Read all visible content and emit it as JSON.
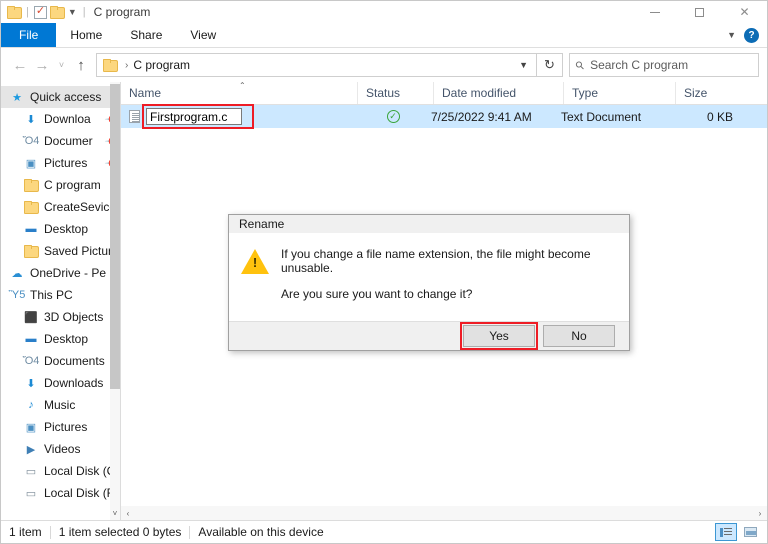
{
  "titlebar": {
    "title": "C program",
    "quick_access_icons": [
      "folder-icon",
      "properties-icon",
      "new-folder-icon",
      "customize-dropdown-icon"
    ],
    "minimize_label": "─",
    "maximize_label": "□",
    "close_label": "✕"
  },
  "ribbon": {
    "tabs": [
      {
        "label": "File",
        "active": true
      },
      {
        "label": "Home",
        "active": false
      },
      {
        "label": "Share",
        "active": false
      },
      {
        "label": "View",
        "active": false
      }
    ],
    "collapse_icon": "chevron-down-icon",
    "help_label": "?"
  },
  "addressbar": {
    "back_icon": "←",
    "forward_icon": "→",
    "recent_icon": "˅",
    "up_icon": "↑",
    "breadcrumb_root_icon": "folder-icon",
    "breadcrumb_separator": "›",
    "breadcrumb": "C program",
    "dropdown_icon": "˅",
    "refresh_icon": "↻",
    "search_icon": "⚲",
    "search_placeholder": "Search C program",
    "search_value": ""
  },
  "sidebar": {
    "items": [
      {
        "label": "Quick access",
        "icon": "star-pin-icon",
        "indent": 0,
        "selected": true,
        "pinned": false
      },
      {
        "label": "Downloa",
        "icon": "download-icon",
        "indent": 1,
        "selected": false,
        "pinned": true
      },
      {
        "label": "Documer",
        "icon": "documents-icon",
        "indent": 1,
        "selected": false,
        "pinned": true
      },
      {
        "label": "Pictures",
        "icon": "pictures-icon",
        "indent": 1,
        "selected": false,
        "pinned": true
      },
      {
        "label": "C program",
        "icon": "folder-icon",
        "indent": 1,
        "selected": false,
        "pinned": false
      },
      {
        "label": "CreateSevice",
        "icon": "folder-icon",
        "indent": 1,
        "selected": false,
        "pinned": false
      },
      {
        "label": "Desktop",
        "icon": "desktop-icon",
        "indent": 1,
        "selected": false,
        "pinned": false
      },
      {
        "label": "Saved Pictur",
        "icon": "folder-icon",
        "indent": 1,
        "selected": false,
        "pinned": false
      },
      {
        "label": "OneDrive - Pe",
        "icon": "onedrive-icon",
        "indent": 0,
        "selected": false,
        "pinned": false
      },
      {
        "label": "This PC",
        "icon": "this-pc-icon",
        "indent": 0,
        "selected": false,
        "pinned": false
      },
      {
        "label": "3D Objects",
        "icon": "3d-objects-icon",
        "indent": 1,
        "selected": false,
        "pinned": false
      },
      {
        "label": "Desktop",
        "icon": "desktop-icon",
        "indent": 1,
        "selected": false,
        "pinned": false
      },
      {
        "label": "Documents",
        "icon": "documents-icon",
        "indent": 1,
        "selected": false,
        "pinned": false
      },
      {
        "label": "Downloads",
        "icon": "download-icon",
        "indent": 1,
        "selected": false,
        "pinned": false
      },
      {
        "label": "Music",
        "icon": "music-icon",
        "indent": 1,
        "selected": false,
        "pinned": false
      },
      {
        "label": "Pictures",
        "icon": "pictures-icon",
        "indent": 1,
        "selected": false,
        "pinned": false
      },
      {
        "label": "Videos",
        "icon": "videos-icon",
        "indent": 1,
        "selected": false,
        "pinned": false
      },
      {
        "label": "Local Disk (C",
        "icon": "drive-icon",
        "indent": 1,
        "selected": false,
        "pinned": false
      },
      {
        "label": "Local Disk (F",
        "icon": "drive-icon",
        "indent": 1,
        "selected": false,
        "pinned": false
      }
    ],
    "scroll_down_icon": "˅"
  },
  "filelist": {
    "columns": [
      {
        "label": "Name",
        "sorted": true
      },
      {
        "label": "Status",
        "sorted": false
      },
      {
        "label": "Date modified",
        "sorted": false
      },
      {
        "label": "Type",
        "sorted": false
      },
      {
        "label": "Size",
        "sorted": false
      }
    ],
    "sort_indicator": "⌃",
    "rows": [
      {
        "name": "Firstprogram.c",
        "renaming": true,
        "status_icon": "cloud-synced-check-icon",
        "status_glyph": "✓",
        "date_modified": "7/25/2022 9:41 AM",
        "type": "Text Document",
        "size": "0 KB",
        "selected": true
      }
    ],
    "hscroll_left_icon": "‹",
    "hscroll_right_icon": "›"
  },
  "dialog": {
    "title": "Rename",
    "warning_icon": "warning-triangle-icon",
    "warning_glyph": "!",
    "message_line1": "If you change a file name extension, the file might become unusable.",
    "message_line2": "Are you sure you want to change it?",
    "yes_label": "Yes",
    "no_label": "No",
    "highlight_color": "#ee1c25"
  },
  "statusbar": {
    "item_count": "1 item",
    "selection": "1 item selected  0 bytes",
    "availability": "Available on this device",
    "view_details_icon": "details-view-icon",
    "view_large_icons_icon": "large-icons-view-icon"
  }
}
